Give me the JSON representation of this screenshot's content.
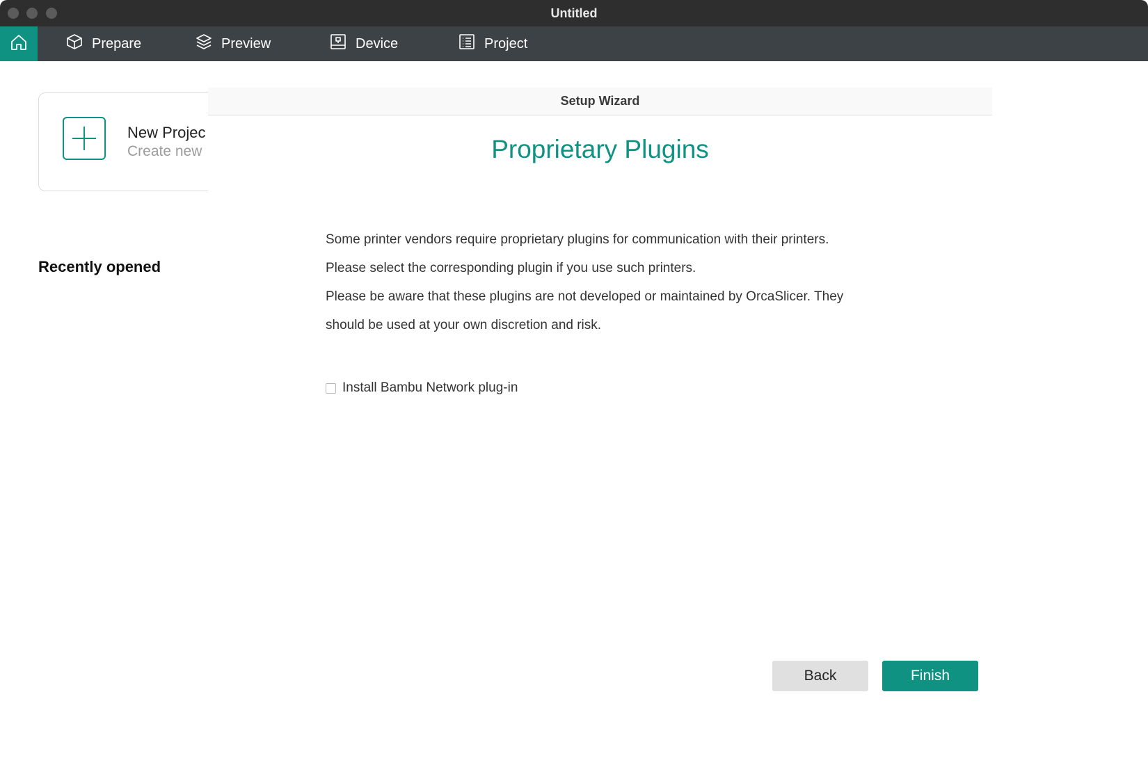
{
  "window": {
    "title": "Untitled"
  },
  "nav": {
    "home_icon": "home-icon",
    "tabs": [
      {
        "label": "Prepare",
        "icon": "cube-icon"
      },
      {
        "label": "Preview",
        "icon": "layers-icon"
      },
      {
        "label": "Device",
        "icon": "device-icon"
      },
      {
        "label": "Project",
        "icon": "list-icon"
      }
    ],
    "active_color": "#109283",
    "bar_color": "#3c4246"
  },
  "home": {
    "new_project": {
      "title": "New Projec",
      "subtitle": "Create new",
      "icon": "plus-icon"
    },
    "recent_heading": "Recently opened"
  },
  "wizard": {
    "header": "Setup Wizard",
    "title": "Proprietary Plugins",
    "paragraphs": [
      "Some printer vendors require proprietary plugins for communication with their printers.",
      "Please select the corresponding plugin if you use such printers.",
      "Please be aware that these plugins are not developed or maintained by OrcaSlicer. They",
      "should be used at your own discretion and risk."
    ],
    "plugin_option": {
      "label": "Install Bambu Network plug-in",
      "checked": false
    },
    "buttons": {
      "back": "Back",
      "finish": "Finish"
    },
    "accent_color": "#109283"
  }
}
